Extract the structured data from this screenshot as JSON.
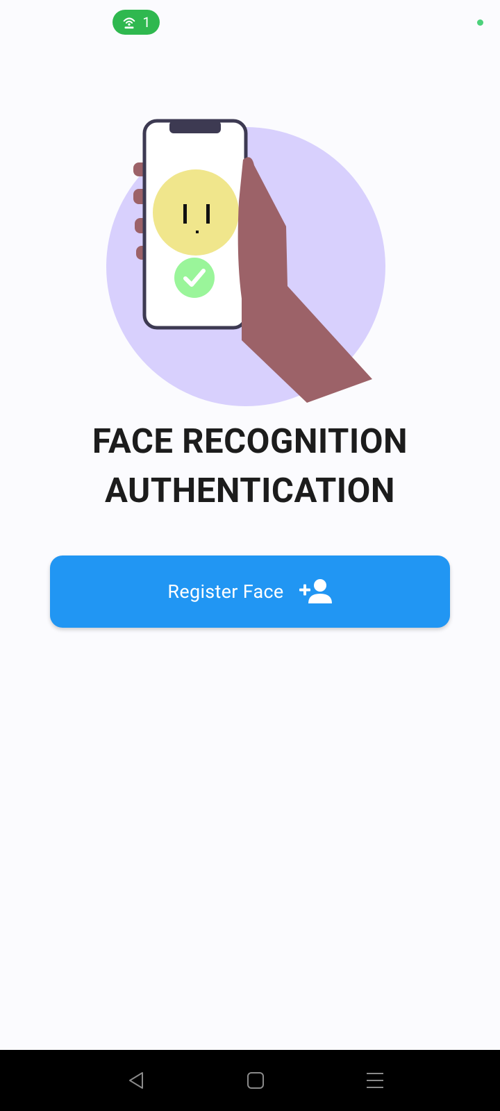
{
  "status_bar": {
    "hotspot_count": "1",
    "colors": {
      "hotspot_pill": "#2fb84f",
      "indicator_dot": "#4cd17b"
    }
  },
  "illustration": {
    "icons": [
      "phone-icon",
      "hand-icon",
      "face-icon",
      "check-icon"
    ],
    "colors": {
      "circle_bg": "#d8d0fd",
      "face": "#f0e68c",
      "check": "#9af59a",
      "hand": "#9c6268"
    }
  },
  "main": {
    "title_line1": "FACE RECOGNITION",
    "title_line2": "AUTHENTICATION",
    "register_button": {
      "label": "Register Face",
      "icon": "person-add-icon",
      "color": "#2196f3"
    }
  },
  "nav_bar": {
    "buttons": [
      "back-icon",
      "home-icon",
      "menu-icon"
    ]
  }
}
